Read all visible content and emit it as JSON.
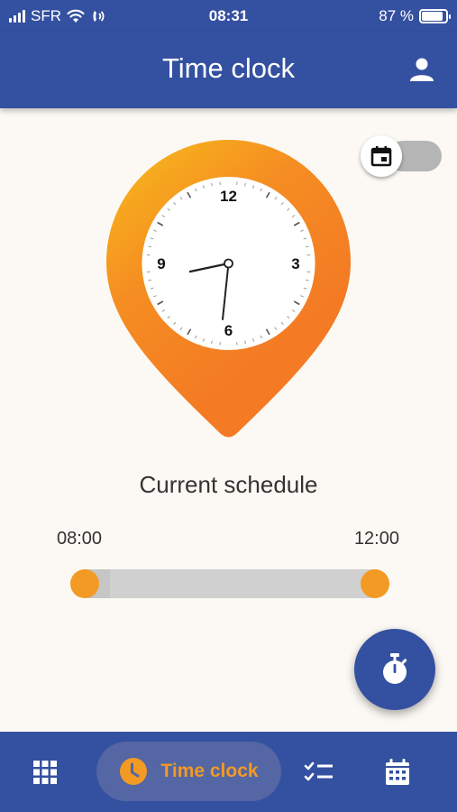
{
  "status_bar": {
    "carrier": "SFR",
    "time": "08:31",
    "battery_percent": "87 %",
    "battery_level": 0.87,
    "icons": [
      "signal-icon",
      "wifi-icon",
      "wifi-calling-icon",
      "battery-icon"
    ]
  },
  "app_bar": {
    "title": "Time clock",
    "icon": "profile-icon"
  },
  "calendar_toggle": {
    "icon": "calendar-icon",
    "on": false
  },
  "clock": {
    "numbers": [
      "12",
      "3",
      "6",
      "9"
    ],
    "hour_hand": "08:31",
    "colors": {
      "pin_top": "#f7b51c",
      "pin_bottom": "#f47f24",
      "face": "#ffffff"
    }
  },
  "schedule": {
    "title": "Current schedule",
    "start": "08:00",
    "end": "12:00"
  },
  "fab": {
    "icon": "stopwatch-icon"
  },
  "bottom_nav": {
    "items": [
      {
        "name": "apps",
        "icon": "grid-icon",
        "label": ""
      },
      {
        "name": "time-clock",
        "icon": "clock-icon",
        "label": "Time clock",
        "active": true
      },
      {
        "name": "tasks",
        "icon": "checklist-icon",
        "label": ""
      },
      {
        "name": "calendar",
        "icon": "calendar-icon",
        "label": ""
      }
    ]
  },
  "colors": {
    "primary": "#3450a0",
    "accent": "#f29a24",
    "background": "#fcf9f4",
    "track": "#d0d0d0"
  }
}
